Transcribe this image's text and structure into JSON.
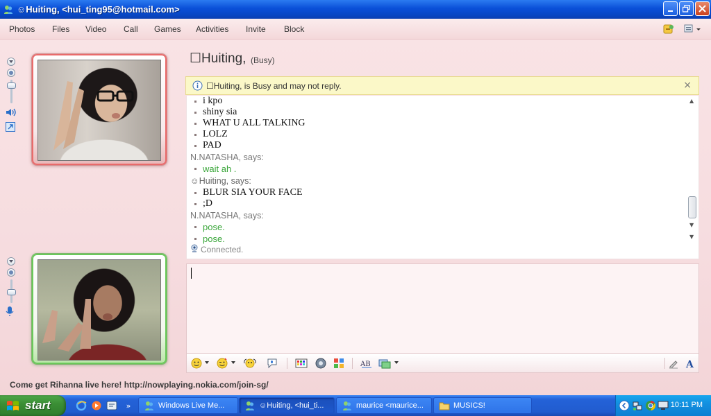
{
  "window": {
    "title": "☺Huiting, <hui_ting95@hotmail.com>"
  },
  "menu": {
    "items": [
      "Photos",
      "Files",
      "Video",
      "Call",
      "Games",
      "Activities",
      "Invite",
      "Block"
    ]
  },
  "contact": {
    "name": "☐Huiting,",
    "status": "(Busy)"
  },
  "busy_notice": {
    "message": "☐Huiting, is Busy and may not reply.",
    "close": "×"
  },
  "conversation": {
    "lines": [
      {
        "type": "msg",
        "text": "i kpo"
      },
      {
        "type": "msg",
        "text": "shiny sia"
      },
      {
        "type": "msg",
        "text": "WHAT U ALL TALKING"
      },
      {
        "type": "msg",
        "text": "LOLZ"
      },
      {
        "type": "msg",
        "text": "PAD"
      },
      {
        "type": "sender",
        "text": "N.NATASHA,  says:"
      },
      {
        "type": "green",
        "text": "wait ah ."
      },
      {
        "type": "sender",
        "text": "☺Huiting, says:"
      },
      {
        "type": "msg",
        "text": "BLUR SIA YOUR FACE"
      },
      {
        "type": "msg",
        "text": ";D"
      },
      {
        "type": "sender",
        "text": "N.NATASHA,  says:"
      },
      {
        "type": "green",
        "text": "pose."
      },
      {
        "type": "green",
        "text": "pose."
      }
    ],
    "connected": "Connected."
  },
  "ad": {
    "text": "Come get Rihanna live here! http://nowplaying.nokia.com/join-sg/"
  },
  "taskbar": {
    "start_label": "start",
    "tasks": [
      {
        "label": "Windows Live Me...",
        "active": false
      },
      {
        "label": "☺Huiting, <hui_ti...",
        "active": true
      },
      {
        "label": "maurice <maurice...",
        "active": false
      },
      {
        "label": "MUSICS!",
        "active": false
      }
    ],
    "clock": "10:11 PM"
  },
  "colors": {
    "busy_bar": "#fbf8c8",
    "green_text": "#3aa63a",
    "contact_frame": "#e96b6b",
    "self_frame": "#6ac85a"
  }
}
